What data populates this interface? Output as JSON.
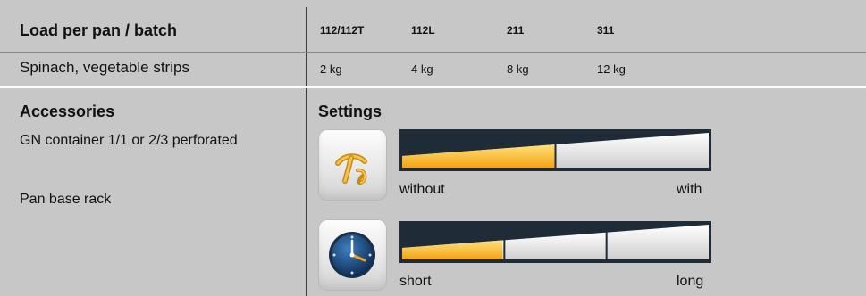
{
  "load": {
    "heading": "Load per pan / batch",
    "row_label": "Spinach, vegetable strips",
    "columns": [
      {
        "model": "112/112T",
        "value": "2 kg"
      },
      {
        "model": "112L",
        "value": "4 kg"
      },
      {
        "model": "211",
        "value": "8 kg"
      },
      {
        "model": "311",
        "value": "12 kg"
      }
    ]
  },
  "accessories": {
    "title": "Accessories",
    "items": [
      "GN container 1/1 or 2/3 perforated",
      "Pan base rack"
    ]
  },
  "settings": {
    "title": "Settings",
    "humidity": {
      "icon": "steam-nozzle-icon",
      "level_fraction": 0.5,
      "min_label": "without",
      "max_label": "with"
    },
    "time": {
      "icon": "clock-icon",
      "level_fraction": 0.33,
      "segments": 3,
      "min_label": "short",
      "max_label": "long"
    }
  },
  "colors": {
    "background": "#c7c7c7",
    "bar_fill": "#f5a316",
    "bar_frame": "#1f2b36",
    "divider": "#ffffff"
  }
}
